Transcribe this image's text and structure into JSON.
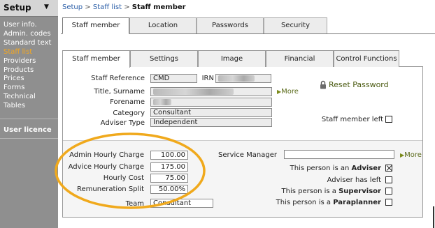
{
  "sidebar": {
    "title": "Setup",
    "caret": "▼",
    "items": [
      {
        "label": "User info.",
        "active": false
      },
      {
        "label": "Admin. codes",
        "active": false
      },
      {
        "label": "Standard text",
        "active": false
      },
      {
        "label": "Staff list",
        "active": true
      },
      {
        "label": "Providers",
        "active": false
      },
      {
        "label": "Products",
        "active": false
      },
      {
        "label": "Prices",
        "active": false
      },
      {
        "label": "Forms",
        "active": false
      },
      {
        "label": "Technical",
        "active": false
      },
      {
        "label": "Tables",
        "active": false
      }
    ],
    "user_licence": "User licence"
  },
  "breadcrumb": {
    "setup": "Setup",
    "sep1": " > ",
    "staff_list": "Staff list",
    "sep2": " > ",
    "current": "Staff member"
  },
  "outer_tabs": [
    "Staff member",
    "Location",
    "Passwords",
    "Security"
  ],
  "inner_tabs": [
    "Staff member",
    "Settings",
    "Image",
    "Financial",
    "Control Functions"
  ],
  "details": {
    "staff_reference_label": "Staff Reference",
    "staff_reference_value": "CMD",
    "irn_label": "IRN",
    "title_surname_label": "Title, Surname",
    "forename_label": "Forename",
    "category_label": "Category",
    "category_value": "Consultant",
    "adviser_type_label": "Adviser Type",
    "adviser_type_value": "Independent",
    "more_label": "More",
    "reset_password": "Reset Password",
    "staff_left_label": "Staff member left"
  },
  "charges": {
    "admin_hourly_label": "Admin Hourly Charge",
    "admin_hourly_value": "100.00",
    "advice_hourly_label": "Advice Hourly Charge",
    "advice_hourly_value": "175.00",
    "hourly_cost_label": "Hourly Cost",
    "hourly_cost_value": "75.00",
    "remuneration_split_label": "Remuneration Split",
    "remuneration_split_value": "50.00%",
    "team_label": "Team",
    "team_value": "Consultant"
  },
  "roles": {
    "service_manager_label": "Service Manager",
    "more_label": "More",
    "adviser_prefix": "This person is an ",
    "adviser_bold": "Adviser",
    "adviser_checked": true,
    "adviser_left_label": "Adviser has left",
    "supervisor_prefix": "This person is a ",
    "supervisor_bold": "Supervisor",
    "paraplanner_prefix": "This person is a ",
    "paraplanner_bold": "Paraplanner"
  },
  "colors": {
    "sidebar_bg": "#8f8f8f",
    "active_item": "#f3a722",
    "link": "#2c5fa8",
    "annotation": "#f0a91c"
  }
}
